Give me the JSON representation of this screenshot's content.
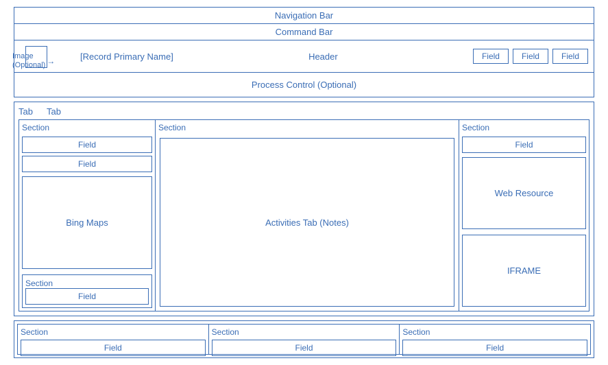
{
  "navBar": {
    "label": "Navigation Bar"
  },
  "cmdBar": {
    "label": "Command Bar"
  },
  "header": {
    "imageLabel": "Image\n(Optional)",
    "recordName": "[Record Primary Name]",
    "centerLabel": "Header",
    "fields": [
      "Field",
      "Field",
      "Field"
    ]
  },
  "processControl": {
    "label": "Process Control (Optional)"
  },
  "tabs": {
    "tab1": "Tab",
    "tab2": "Tab",
    "col1": {
      "section1Label": "Section",
      "field1": "Field",
      "field2": "Field",
      "bingMaps": "Bing Maps",
      "section2Label": "Section",
      "field3": "Field"
    },
    "col2": {
      "sectionLabel": "Section",
      "activitiesTab": "Activities Tab (Notes)"
    },
    "col3": {
      "sectionLabel": "Section",
      "field1": "Field",
      "webResource": "Web Resource",
      "iframe": "IFRAME"
    }
  },
  "bottomSections": {
    "col1": {
      "label": "Section",
      "field": "Field"
    },
    "col2": {
      "label": "Section",
      "field": "Field"
    },
    "col3": {
      "label": "Section",
      "field": "Field"
    }
  }
}
